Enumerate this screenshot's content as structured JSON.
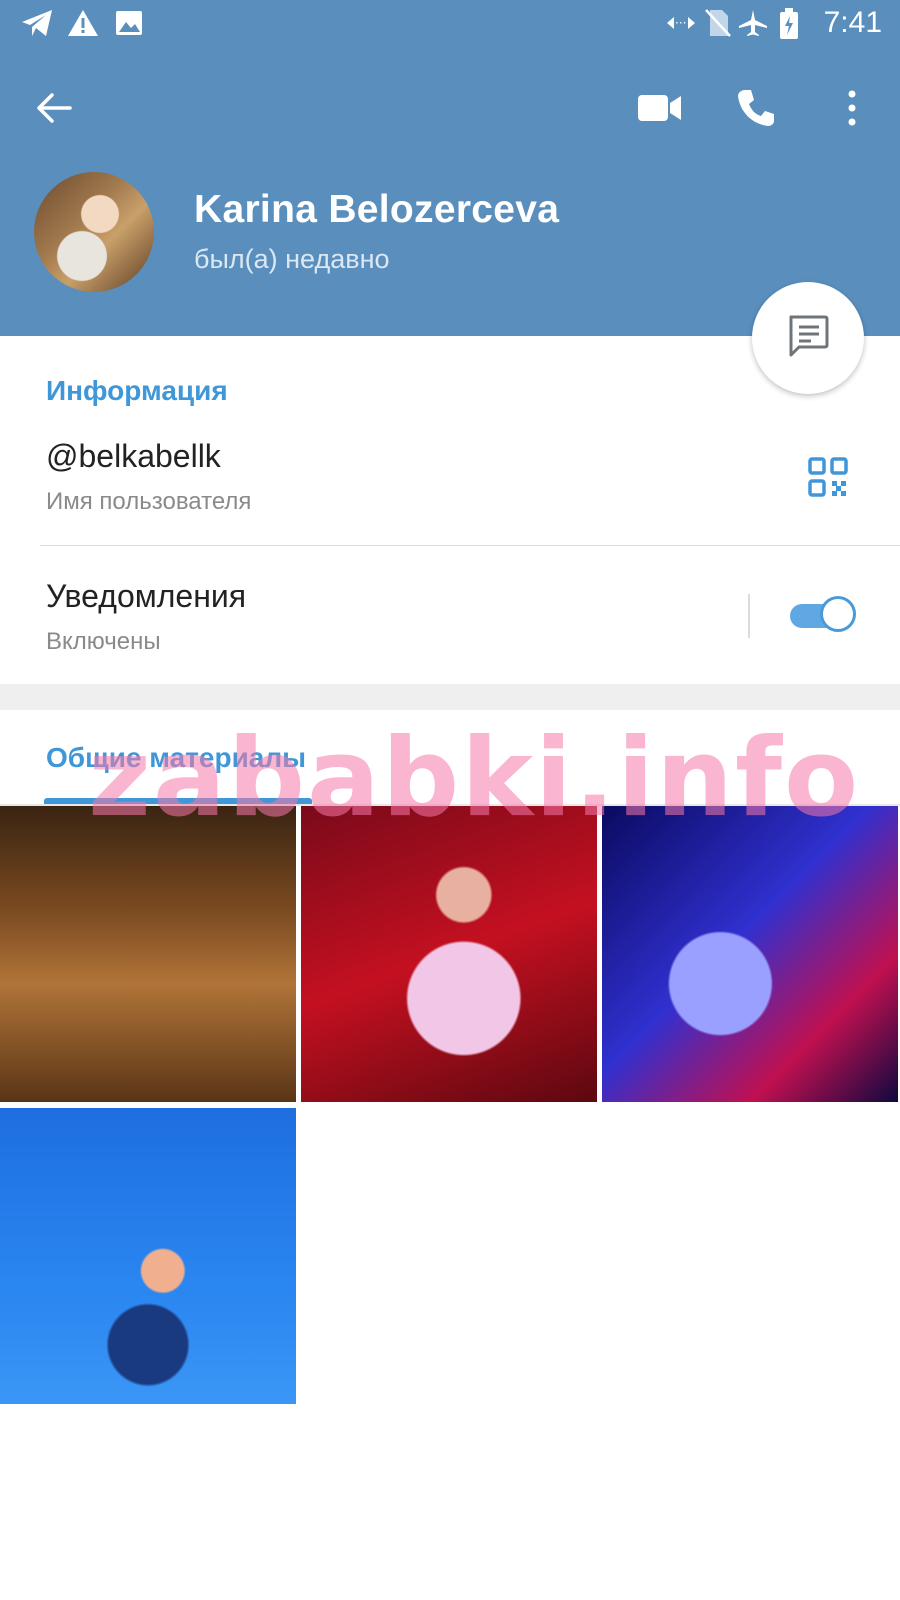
{
  "status_bar": {
    "time": "7:41",
    "icons": [
      "telegram-icon",
      "warning-icon",
      "image-icon",
      "data-arrows-icon",
      "no-sim-icon",
      "airplane-icon",
      "battery-charging-icon"
    ]
  },
  "toolbar": {
    "back": "arrow-left-icon",
    "video_call": "video-camera-icon",
    "voice_call": "phone-icon",
    "more": "more-vertical-icon"
  },
  "profile": {
    "name": "Karina Belozerceva",
    "status": "был(а) недавно"
  },
  "info": {
    "section_title": "Информация",
    "username": "@belkabellk",
    "username_label": "Имя пользователя",
    "notifications_title": "Уведомления",
    "notifications_status": "Включены",
    "notifications_enabled": true
  },
  "shared": {
    "section_title": "Общие материалы",
    "media_count": 4
  },
  "watermark": "zababki.info",
  "colors": {
    "header": "#5a8fbd",
    "accent": "#3f97d8"
  }
}
